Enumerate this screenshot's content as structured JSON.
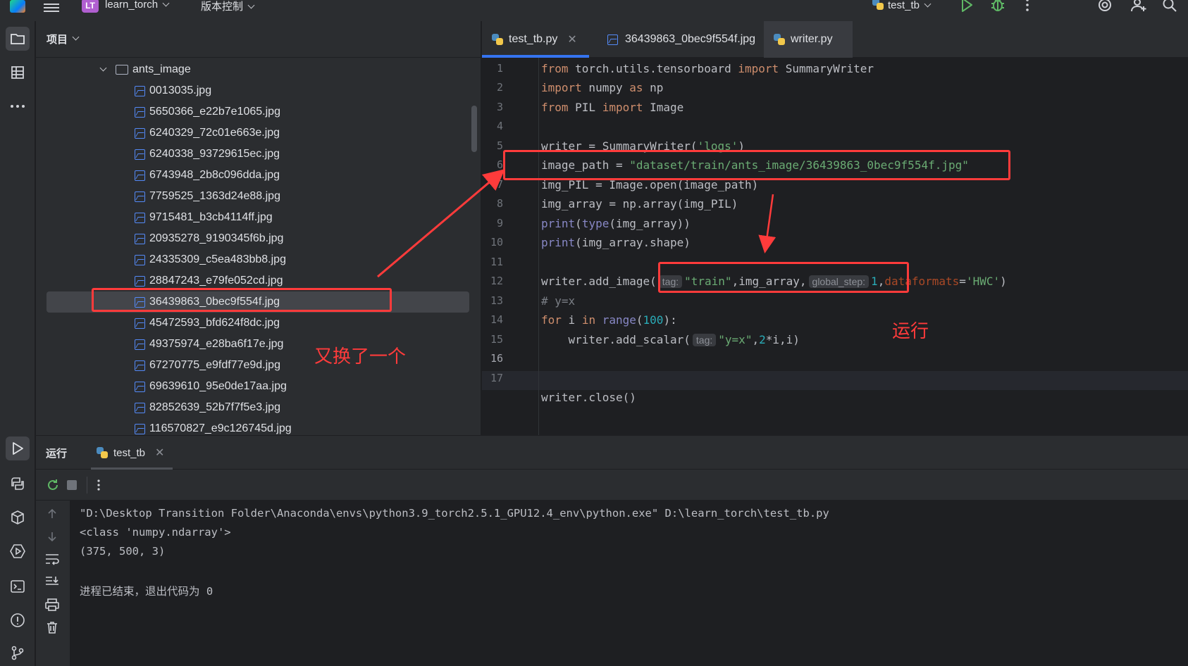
{
  "titlebar": {
    "project_badge": "LT",
    "project_name": "learn_torch",
    "vcs_label": "版本控制",
    "run_config": "test_tb"
  },
  "project_panel": {
    "title": "项目",
    "folder": "ants_image",
    "files": [
      "0013035.jpg",
      "5650366_e22b7e1065.jpg",
      "6240329_72c01e663e.jpg",
      "6240338_93729615ec.jpg",
      "6743948_2b8c096dda.jpg",
      "7759525_1363d24e88.jpg",
      "9715481_b3cb4114ff.jpg",
      "20935278_9190345f6b.jpg",
      "24335309_c5ea483bb8.jpg",
      "28847243_e79fe052cd.jpg",
      "36439863_0bec9f554f.jpg",
      "45472593_bfd624f8dc.jpg",
      "49375974_e28ba6f17e.jpg",
      "67270775_e9fdf77e9d.jpg",
      "69639610_95e0de17aa.jpg",
      "82852639_52b7f7f5e3.jpg",
      "116570827_e9c126745d.jpg"
    ],
    "selected_file": "36439863_0bec9f554f.jpg"
  },
  "editor": {
    "tabs": [
      "test_tb.py",
      "36439863_0bec9f554f.jpg",
      "writer.py"
    ],
    "active_tab": "test_tb.py",
    "line_numbers": [
      "1",
      "2",
      "3",
      "4",
      "5",
      "6",
      "7",
      "8",
      "9",
      "10",
      "11",
      "12",
      "13",
      "14",
      "15",
      "16",
      "17"
    ],
    "current_line": "16",
    "code": {
      "l1_kw1": "from",
      "l1_mod": " torch.utils.tensorboard ",
      "l1_kw2": "import",
      "l1_name": " SummaryWriter",
      "l2_kw1": "import",
      "l2_mod": " numpy ",
      "l2_kw2": "as",
      "l2_name": " np",
      "l3_kw1": "from",
      "l3_mod": " PIL ",
      "l3_kw2": "import",
      "l3_name": " Image",
      "l5_a": "writer = SummaryWriter(",
      "l5_str": "'logs'",
      "l5_b": ")",
      "l6_a": "image_path = ",
      "l6_str": "\"dataset/train/ants_image/36439863_0bec9f554f.jpg\"",
      "l7": "img_PIL = Image.open(image_path)",
      "l8": "img_array = np.array(img_PIL)",
      "l9_fn": "print",
      "l9_a": "(",
      "l9_bi": "type",
      "l9_b": "(img_array))",
      "l10_fn": "print",
      "l10_b": "(img_array.shape)",
      "l12_a": "writer.add_image(",
      "l12_hint1": "tag:",
      "l12_str1": "\"train\"",
      "l12_b": ",img_array,",
      "l12_hint2": "global_step:",
      "l12_num": "1",
      "l12_c": ",",
      "l12_named": "dataformats",
      "l12_eq": "=",
      "l12_str2": "'HWC'",
      "l12_d": ")",
      "l13": "# y=x",
      "l14_kw1": "for",
      "l14_a": " i ",
      "l14_kw2": "in",
      "l14_sp": " ",
      "l14_bi": "range",
      "l14_b": "(",
      "l14_num": "100",
      "l14_c": "):",
      "l15_a": "    writer.add_scalar(",
      "l15_hint": "tag:",
      "l15_str": "\"y=x\"",
      "l15_b": ",",
      "l15_num": "2",
      "l15_c": "*i,i)",
      "l17": "writer.close()"
    }
  },
  "run_panel": {
    "title": "运行",
    "tab": "test_tb",
    "output": [
      "\"D:\\Desktop Transition Folder\\Anaconda\\envs\\python3.9_torch2.5.1_GPU12.4_env\\python.exe\" D:\\learn_torch\\test_tb.py",
      "<class 'numpy.ndarray'>",
      "(375, 500, 3)",
      "",
      "进程已结束，退出代码为 0"
    ]
  },
  "annotations": {
    "note_swap": "又换了一个",
    "note_run": "运行"
  },
  "colors": {
    "accent": "#3574f0",
    "annotation": "#ff3b3b",
    "keyword": "#cf8e6d",
    "string": "#6aab73",
    "number": "#2aacb8"
  }
}
